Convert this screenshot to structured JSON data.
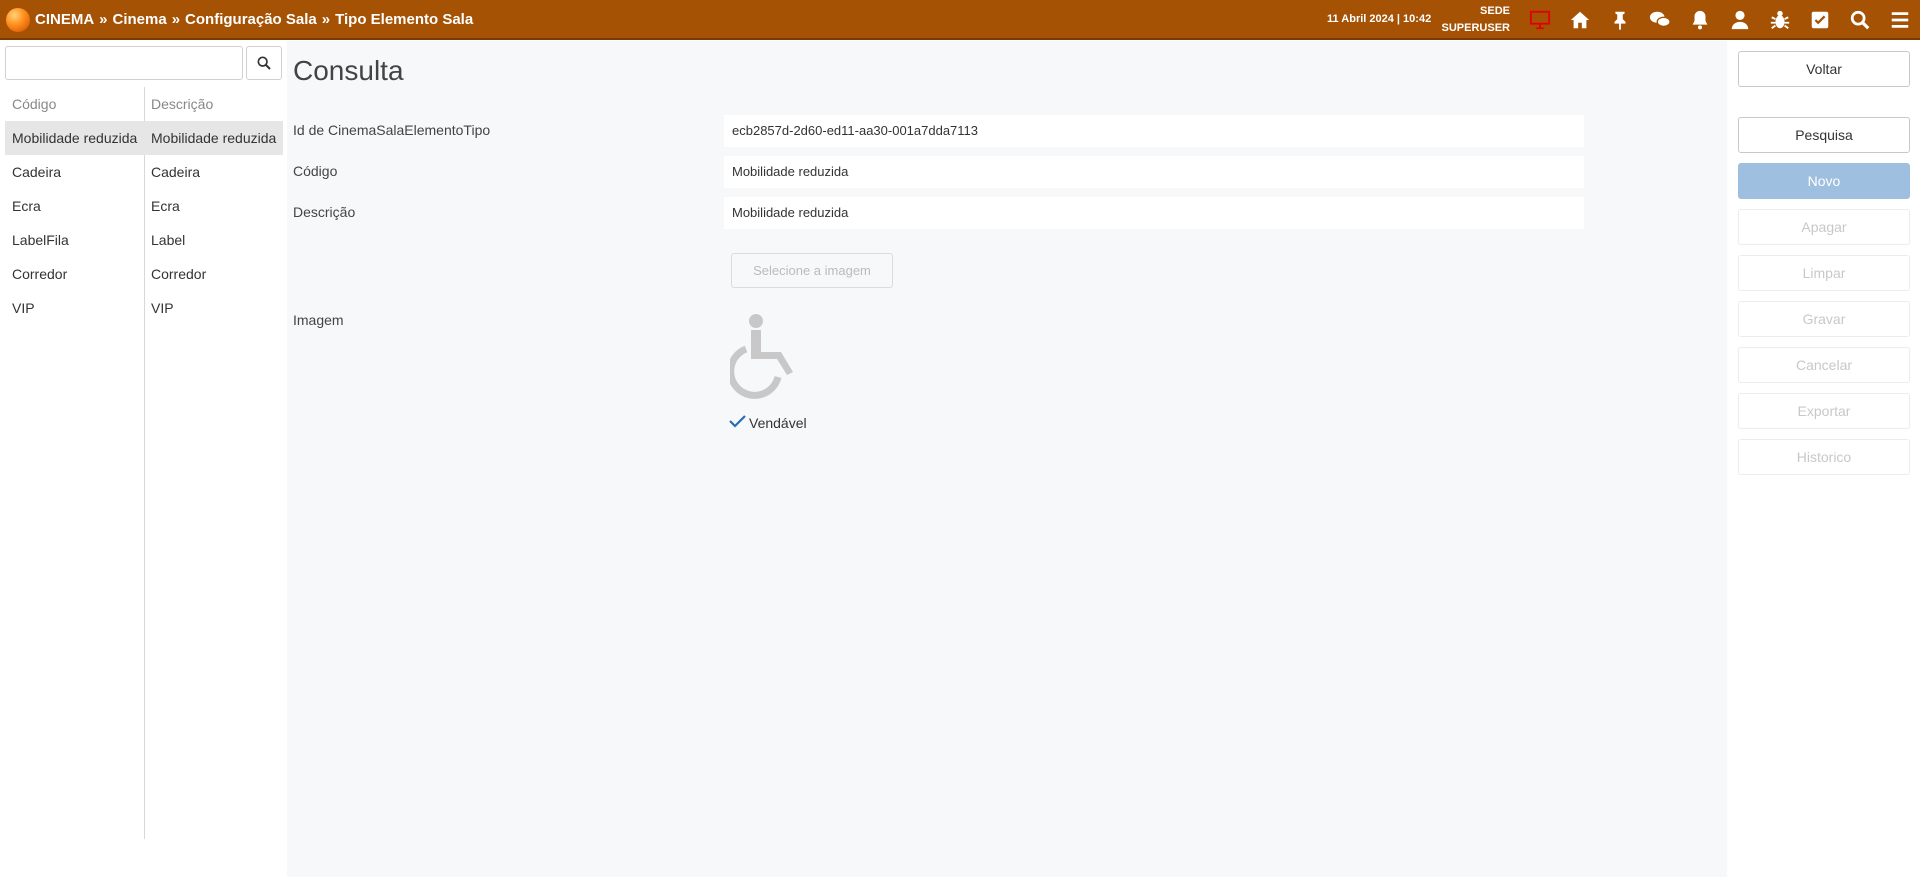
{
  "header": {
    "breadcrumb": [
      "CINEMA",
      "Cinema",
      "Configuração Sala",
      "Tipo Elemento Sala"
    ],
    "separator": "»",
    "datetime": "11 Abril 2024 | 10:42",
    "location": "SEDE",
    "user": "SUPERUSER",
    "icons": [
      "monitor-icon",
      "home-icon",
      "pin-icon",
      "chat-icon",
      "bell-icon",
      "user-icon",
      "bug-icon",
      "checkbox-icon",
      "search-icon",
      "menu-icon"
    ],
    "accent_color": "#a55204"
  },
  "sidebar": {
    "search": {
      "value": "",
      "placeholder": ""
    },
    "columns": [
      "Código",
      "Descrição"
    ],
    "rows": [
      {
        "code": "Mobilidade reduzida",
        "description": "Mobilidade reduzida",
        "selected": true
      },
      {
        "code": "Cadeira",
        "description": "Cadeira"
      },
      {
        "code": "Ecra",
        "description": "Ecra"
      },
      {
        "code": "LabelFila",
        "description": "Label"
      },
      {
        "code": "Corredor",
        "description": "Corredor"
      },
      {
        "code": "VIP",
        "description": "VIP"
      }
    ]
  },
  "form": {
    "title": "Consulta",
    "fields": {
      "id": {
        "label": "Id de CinemaSalaElementoTipo",
        "value": "ecb2857d-2d60-ed11-aa30-001a7dda7113"
      },
      "code": {
        "label": "Código",
        "value": "Mobilidade reduzida"
      },
      "description": {
        "label": "Descrição",
        "value": "Mobilidade reduzida"
      }
    },
    "image": {
      "label": "Imagem",
      "select_button": "Selecione a imagem",
      "icon": "wheelchair-icon"
    },
    "sellable": {
      "label": "Vendável",
      "checked": true
    }
  },
  "actions": {
    "back": "Voltar",
    "search": "Pesquisa",
    "new": "Novo",
    "delete": "Apagar",
    "clear": "Limpar",
    "save": "Gravar",
    "cancel": "Cancelar",
    "export": "Exportar",
    "history": "Historico"
  }
}
